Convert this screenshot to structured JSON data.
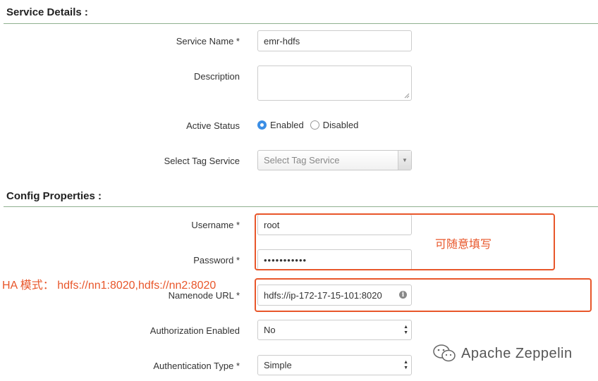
{
  "service_details": {
    "title": "Service Details :",
    "service_name": {
      "label": "Service Name *",
      "value": "emr-hdfs"
    },
    "description": {
      "label": "Description",
      "value": ""
    },
    "active_status": {
      "label": "Active Status",
      "options": [
        "Enabled",
        "Disabled"
      ],
      "selected": "Enabled"
    },
    "select_tag_service": {
      "label": "Select Tag Service",
      "placeholder": "Select Tag Service"
    }
  },
  "config_properties": {
    "title": "Config Properties :",
    "username": {
      "label": "Username *",
      "value": "root"
    },
    "password": {
      "label": "Password *",
      "value": "•••••••••••"
    },
    "namenode_url": {
      "label": "Namenode URL *",
      "value": "hdfs://ip-172-17-15-101:8020"
    },
    "authorization_enabled": {
      "label": "Authorization Enabled",
      "value": "No"
    },
    "authentication_type": {
      "label": "Authentication Type *",
      "value": "Simple"
    }
  },
  "annotations": {
    "credentials_note": "可随意填写",
    "ha_note": "HA 模式： hdfs://nn1:8020,hdfs://nn2:8020",
    "color": "#e8562a"
  },
  "watermark": {
    "text": "Apache Zeppelin",
    "icon": "wechat-icon"
  }
}
